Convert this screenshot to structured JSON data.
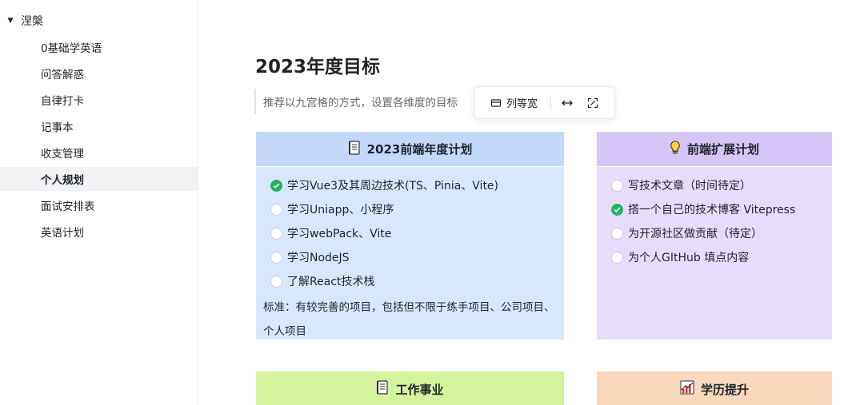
{
  "sidebar": {
    "parent": {
      "label": "涅槃",
      "expanded": true
    },
    "items": [
      {
        "label": "0基础学英语"
      },
      {
        "label": "问答解惑"
      },
      {
        "label": "自律打卡"
      },
      {
        "label": "记事本"
      },
      {
        "label": "收支管理"
      },
      {
        "label": "个人规划",
        "active": true
      },
      {
        "label": "面试安排表"
      },
      {
        "label": "英语计划"
      }
    ]
  },
  "doc": {
    "title": "2023年度目标",
    "quote": "推荐以九宫格的方式，设置各维度的目标"
  },
  "toolbar": {
    "equal_width_label": "列等宽",
    "icons": [
      "column-width-icon",
      "horizontal-resize-icon",
      "fullscreen-icon"
    ]
  },
  "cards": [
    {
      "title": "2023前端年度计划",
      "icon": "notebook-icon",
      "items": [
        {
          "label": "学习Vue3及其周边技术(TS、Pinia、Vite)",
          "checked": true
        },
        {
          "label": "学习Uniapp、小程序",
          "checked": false
        },
        {
          "label": "学习webPack、Vite",
          "checked": false
        },
        {
          "label": "学习NodeJS",
          "checked": false
        },
        {
          "label": "了解React技术栈",
          "checked": false
        }
      ],
      "note": "标准：有较完善的项目，包括但不限于练手项目、公司项目、个人项目"
    },
    {
      "title": "前端扩展计划",
      "icon": "lightbulb-icon",
      "items": [
        {
          "label": "写技术文章（时间待定）",
          "checked": false
        },
        {
          "label": "搭一个自己的技术博客 Vitepress",
          "checked": true
        },
        {
          "label": "为开源社区做贡献（待定）",
          "checked": false
        },
        {
          "label": "为个人GItHub 填点内容",
          "checked": false
        }
      ]
    },
    {
      "title": "工作事业",
      "icon": "notebook-icon"
    },
    {
      "title": "学历提升",
      "icon": "chart-up-icon"
    }
  ],
  "colors": {
    "card1_head": "#c3d8fb",
    "card1_body": "#d9e7fd",
    "card2_head": "#d6c6f7",
    "card2_body": "#e7dcfa",
    "card3": "#d5f29d",
    "card4": "#f8d9bd",
    "checked": "#22b35e"
  }
}
